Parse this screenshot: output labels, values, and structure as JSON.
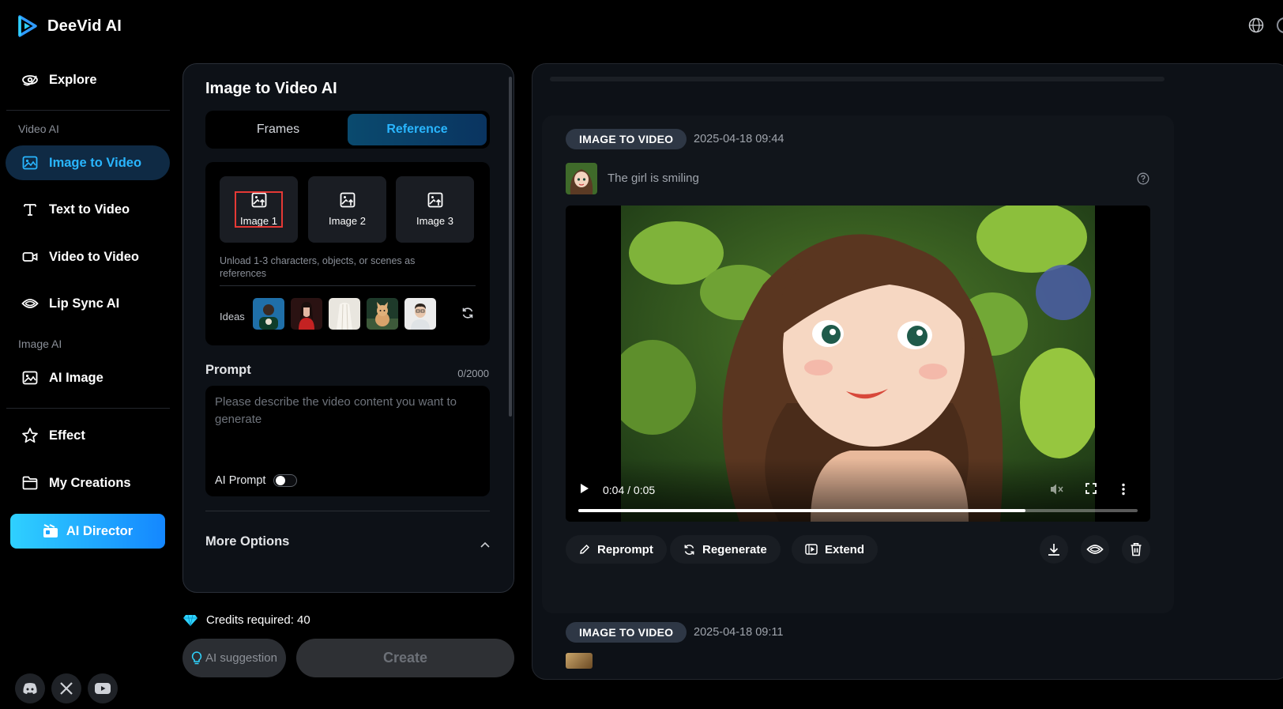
{
  "app": {
    "name": "DeeVid AI"
  },
  "sidebar": {
    "explore": "Explore",
    "video_section": "Video AI",
    "video_items": [
      {
        "label": "Image to Video",
        "icon": "image-icon",
        "active": true
      },
      {
        "label": "Text to Video",
        "icon": "text-icon"
      },
      {
        "label": "Video to Video",
        "icon": "video-camera-icon"
      },
      {
        "label": "Lip Sync AI",
        "icon": "eye-icon"
      }
    ],
    "image_section": "Image AI",
    "ai_image": "AI Image",
    "effect": "Effect",
    "my_creations": "My Creations",
    "director": "AI Director",
    "social": [
      "discord-icon",
      "x-icon",
      "youtube-icon"
    ]
  },
  "generator": {
    "title": "Image to Video AI",
    "tabs": [
      "Frames",
      "Reference"
    ],
    "active_tab": "Reference",
    "slots": [
      "Image 1",
      "Image 2",
      "Image 3"
    ],
    "selected_slot": "Image 1",
    "hint": "Unload 1-3 characters, objects, or scenes as references",
    "ideas_label": "Ideas",
    "prompt": {
      "label": "Prompt",
      "count": "0/2000",
      "placeholder": "Please describe the video content you want to generate",
      "value": "",
      "ai_prompt_label": "AI Prompt",
      "ai_prompt_enabled": false
    },
    "more_options": "More Options",
    "credits": "Credits required: 40",
    "suggestion_btn": "AI suggestion",
    "create_btn": "Create"
  },
  "results": [
    {
      "badge": "IMAGE TO VIDEO",
      "date": "2025-04-18 09:44",
      "caption": "The girl is smiling",
      "player": {
        "time": "0:04 / 0:05",
        "progress": 0.8
      },
      "actions": [
        "Reprompt",
        "Regenerate",
        "Extend"
      ],
      "tools": [
        "download-icon",
        "eye-icon",
        "trash-icon"
      ]
    },
    {
      "badge": "IMAGE TO VIDEO",
      "date": "2025-04-18 09:11"
    }
  ],
  "colors": {
    "accent": "#29b6ff",
    "active_bg": "#0f2a44",
    "panel": "#0d1117",
    "selected_border": "#e53935"
  }
}
